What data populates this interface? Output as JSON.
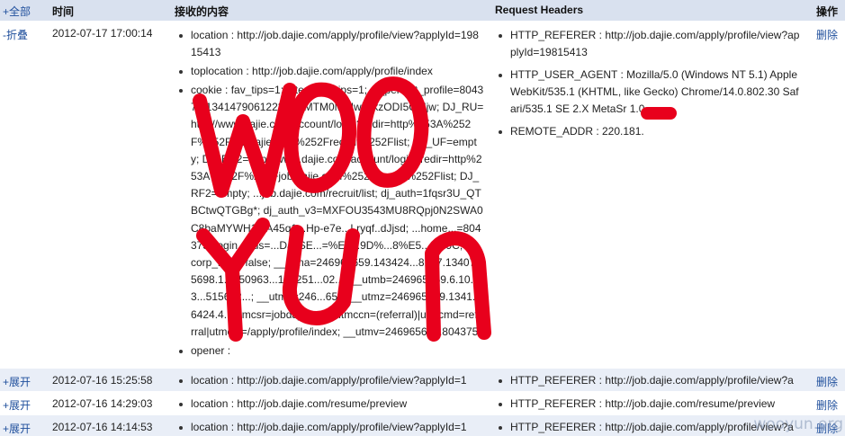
{
  "header": {
    "toggle_all": "+全部",
    "col_time": "时间",
    "col_content": "接收的内容",
    "col_headers": "Request Headers",
    "col_actions": "操作"
  },
  "rows": [
    {
      "toggle": "-折叠",
      "time": "2012-07-17 17:00:14",
      "content": [
        "location : http://job.dajie.com/apply/profile/view?applyId=19815413",
        "toplocation : http://job.dajie.com/apply/profile/index",
        "cookie : fav_tips=1; interview_tips=1; dj_perfect_profile=804375:1341479061223@...MTM0MjUwMjkzODI5OMjw; DJ_RU=http://www.dajie.com/account/login?redir=http%253A%252F%252Fjob.dajie.com%252Frecruit%252Flist; DJ_UF=empty; DJ_EU2=http://www.dajie.com/account/login?redir=http%253A%252F%252Fjob.dajie.com%252Frecruit%252Flist; DJ_RF2=empty; ...job.dajie.com/recruit/list; dj_auth=1fqsr3U_QTBCtwQTGBg*; dj_auth_v3=MXFOU3543MU8RQpj0N2SWA0C8baMYWH1_fA45q1...Hp-e7e...Lryqf..dJjsd; ...home...=804375; login_...us=...DJ_SE...=%E6...9D%...8%E5...8%9C; dj_corp_bu...=false; __utma=246965659.143424...8137.1340765698.1...250963...134251...02...; __utmb=246965659.6.10.13...515602...; __utmc=246...659; __utmz=246965659.1341...6424.4...utmcsr=jobdajie.com|utmccn=(referral)|utmcmd=referral|utmcct=/apply/profile/index; __utmv=246965659.804375",
        "opener :"
      ],
      "headers": [
        "HTTP_REFERER : http://job.dajie.com/apply/profile/view?applyId=19815413",
        "HTTP_USER_AGENT : Mozilla/5.0 (Windows NT 5.1) AppleWebKit/535.1 (KHTML, like Gecko) Chrome/14.0.802.30 Safari/535.1 SE 2.X MetaSr 1.0",
        "REMOTE_ADDR : 220.181."
      ],
      "delete": "删除"
    },
    {
      "toggle": "+展开",
      "time": "2012-07-16 15:25:58",
      "content": [
        "location : http://job.dajie.com/apply/profile/view?applyId=1"
      ],
      "headers": [
        "HTTP_REFERER : http://job.dajie.com/apply/profile/view?a"
      ],
      "delete": "删除"
    },
    {
      "toggle": "+展开",
      "time": "2012-07-16 14:29:03",
      "content": [
        "location : http://job.dajie.com/resume/preview"
      ],
      "headers": [
        "HTTP_REFERER : http://job.dajie.com/resume/preview"
      ],
      "delete": "删除"
    },
    {
      "toggle": "+展开",
      "time": "2012-07-16 14:14:53",
      "content": [
        "location : http://job.dajie.com/apply/profile/view?applyId=1"
      ],
      "headers": [
        "HTTP_REFERER : http://job.dajie.com/apply/profile/view?a"
      ],
      "delete": "删除"
    }
  ],
  "overlay_text": [
    "WOO",
    "YUN"
  ],
  "watermark": "wooyun.org",
  "colors": {
    "header_bg": "#d9e1ef",
    "odd_row_bg": "#e9eef7",
    "link": "#1f4f9c",
    "scribble": "#e8001c"
  }
}
